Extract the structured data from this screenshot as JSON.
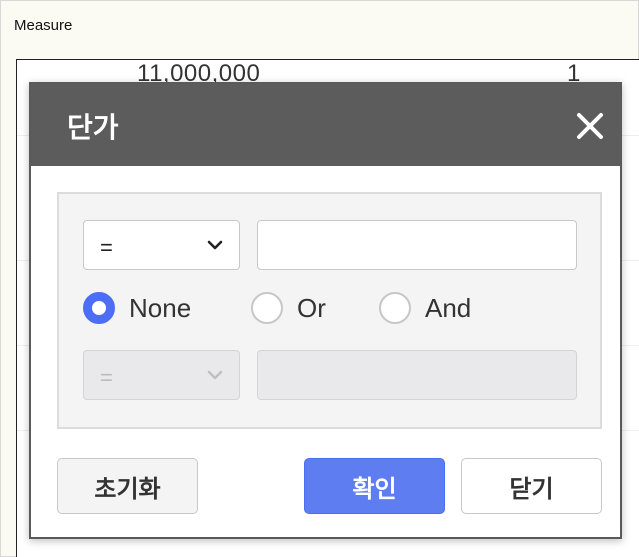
{
  "background": {
    "header_label": "Measure",
    "grid_row": {
      "amount": "11,000,000",
      "count": "1"
    }
  },
  "dialog": {
    "title": "단가",
    "close_icon": "close-icon",
    "filter": {
      "operator1": "=",
      "value1": "",
      "logic_options": [
        {
          "label": "None",
          "checked": true
        },
        {
          "label": "Or",
          "checked": false
        },
        {
          "label": "And",
          "checked": false
        }
      ],
      "operator2": "=",
      "operator2_disabled": true,
      "value2": "",
      "value2_disabled": true
    },
    "buttons": {
      "reset": "초기화",
      "ok": "확인",
      "close": "닫기"
    }
  },
  "colors": {
    "titlebar": "#5c5c5c",
    "accent": "#4c6ef5",
    "ok_button": "#5e7df0"
  }
}
